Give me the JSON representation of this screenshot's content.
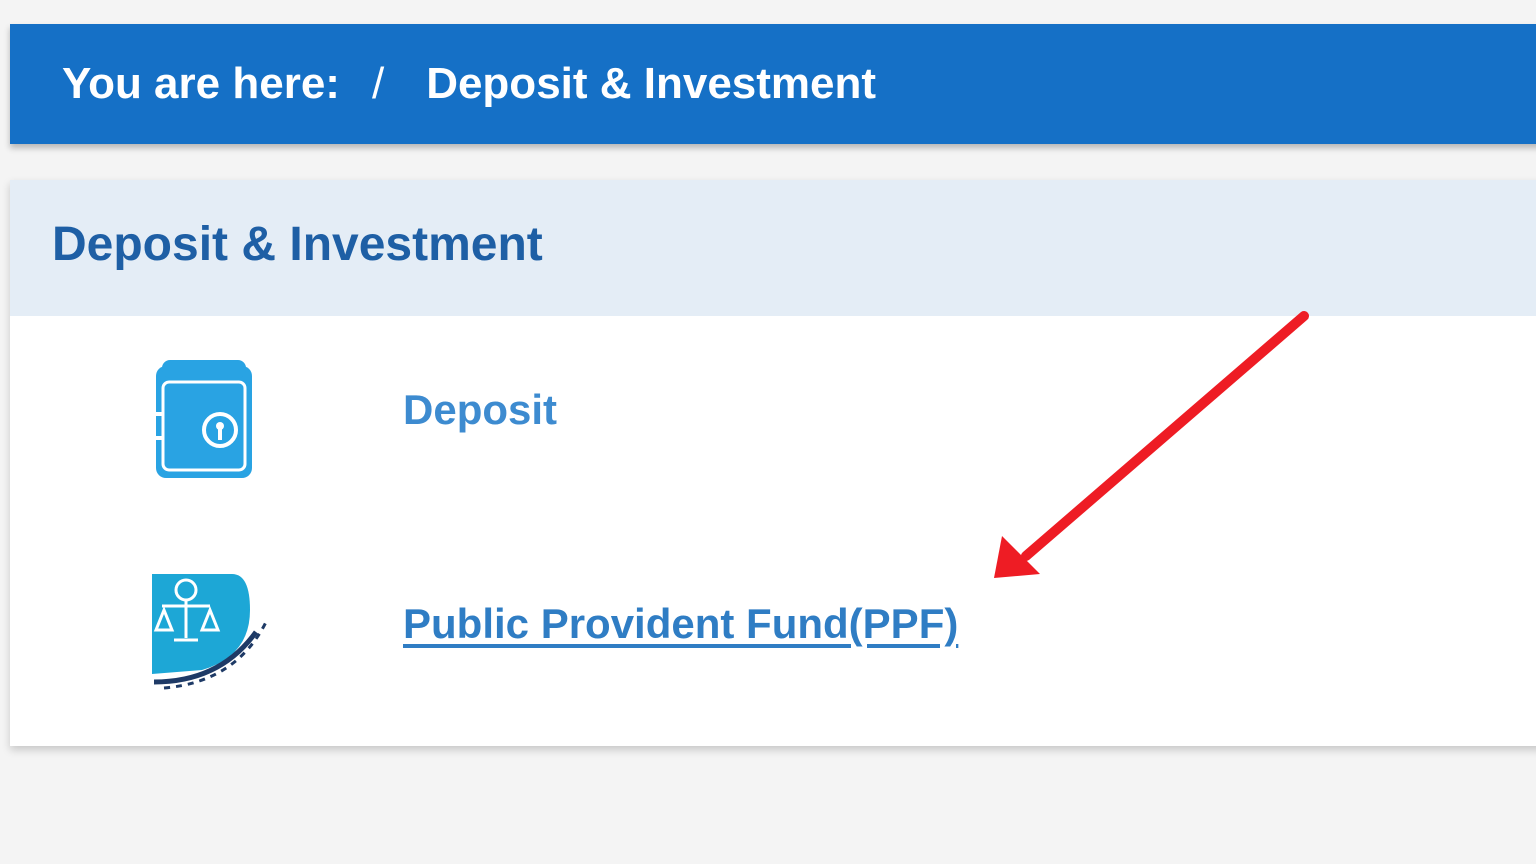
{
  "breadcrumb": {
    "prefix": "You are here:",
    "separator": "/",
    "current": "Deposit & Investment"
  },
  "panel": {
    "title": "Deposit & Investment",
    "items": [
      {
        "label": "Deposit",
        "icon": "safe-locker-icon"
      },
      {
        "label": "Public Provident Fund(PPF)",
        "icon": "ppf-scales-icon"
      }
    ]
  },
  "colors": {
    "breadcrumb_bg": "#1570c6",
    "panel_header_bg": "#e4edf6",
    "title_text": "#1e5fa5",
    "link_text": "#2f7dc4",
    "annotation_arrow": "#ee1c24"
  }
}
